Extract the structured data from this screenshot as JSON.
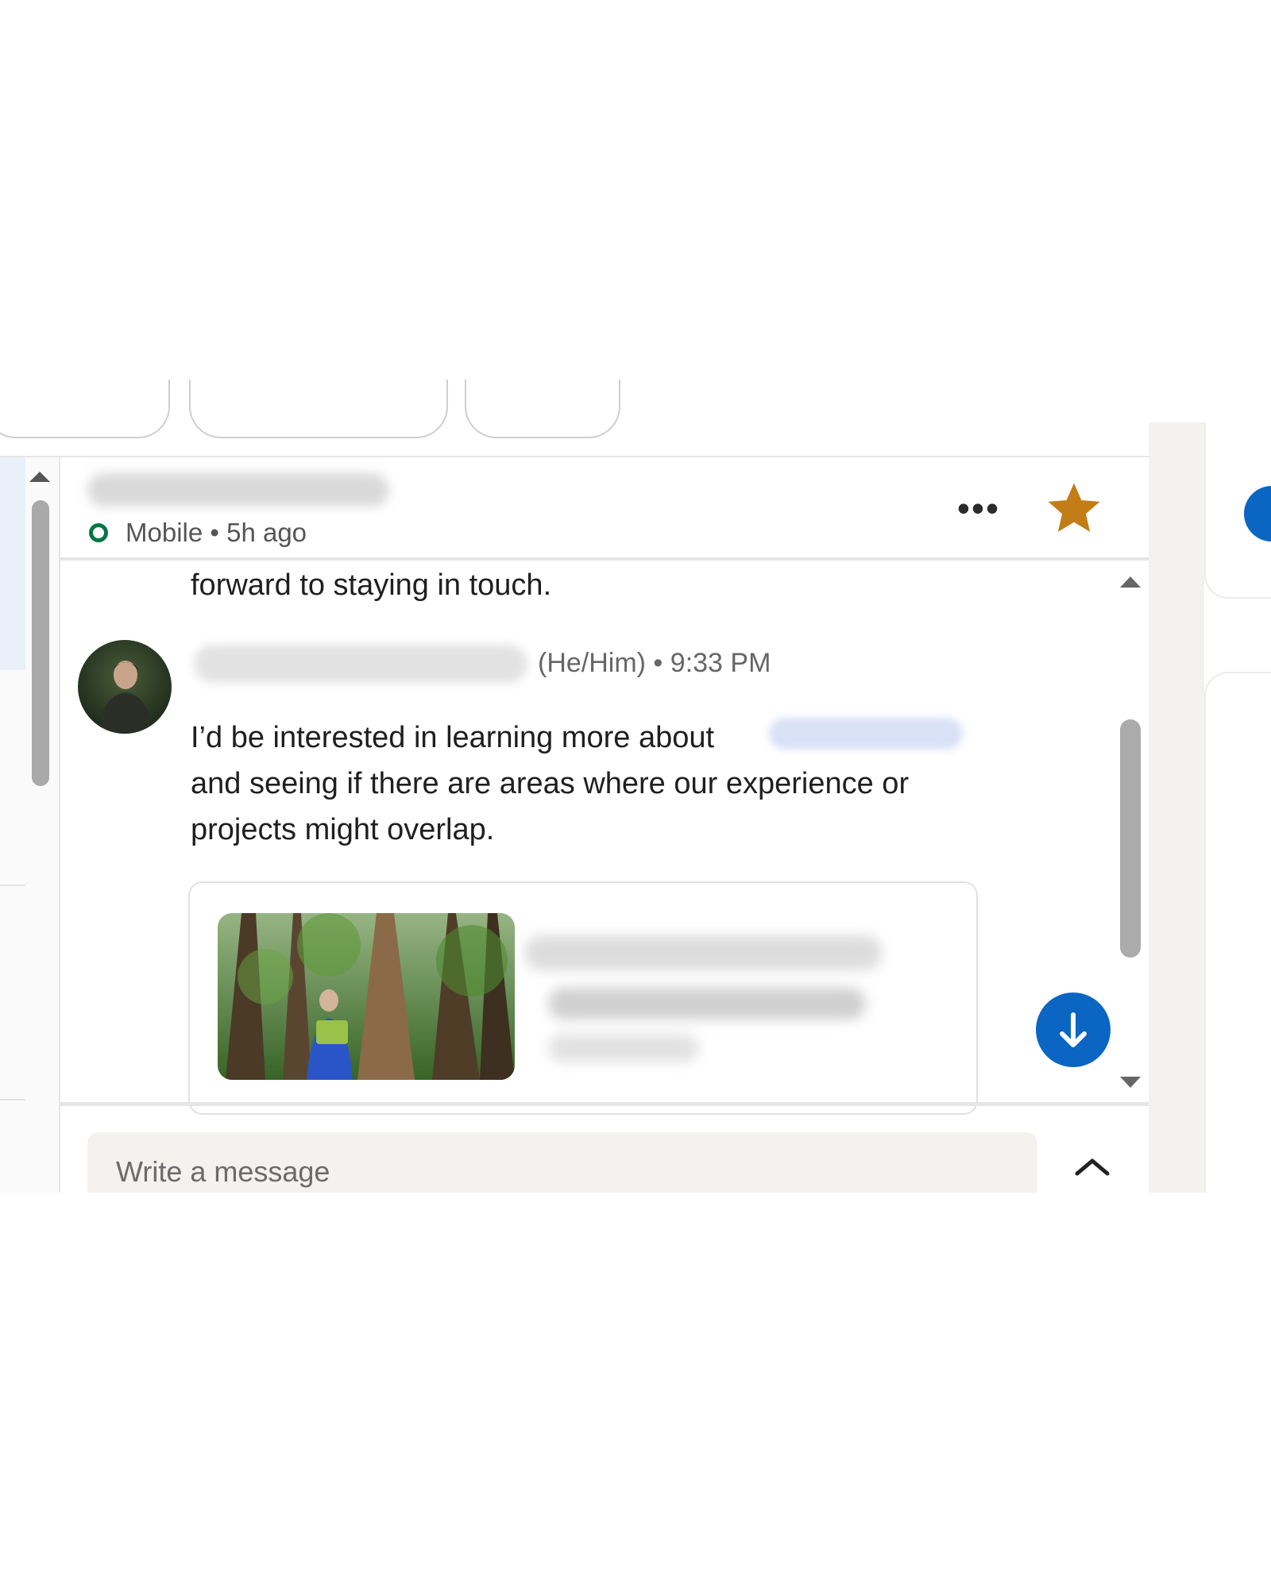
{
  "header": {
    "presence": "Mobile",
    "last_active": "5h ago",
    "presence_line": "Mobile • 5h ago",
    "more_icon": "more-options-icon",
    "star_icon": "star-icon",
    "star_color": "#c37d16"
  },
  "messages": {
    "previous_tail": "forward to staying in touch.",
    "current": {
      "sender_pronouns_time": "(He/Him) • 9:33 PM",
      "line1": "I’d be interested in learning more about",
      "line2": " and seeing if there are areas where our experience or",
      "line3": "projects might overlap."
    }
  },
  "jump_button": {
    "icon": "arrow-down-icon",
    "color": "#0a66c2"
  },
  "composer": {
    "placeholder": "Write a message",
    "expand_icon": "chevron-up-icon"
  },
  "presence_color": "#057642"
}
